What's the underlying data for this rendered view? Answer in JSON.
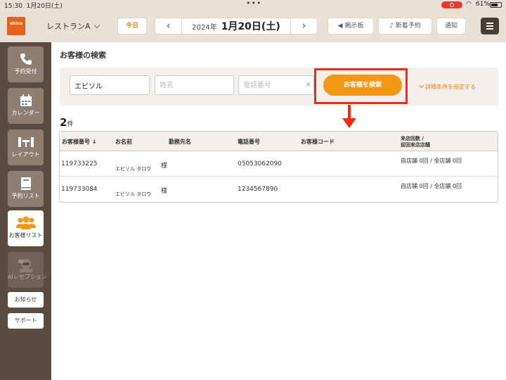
{
  "status_bar": {
    "time": "15:30",
    "date": "1月20日(土)",
    "battery": "61%"
  },
  "header": {
    "logo_text": "ebica",
    "restaurant": "レストランA",
    "today_label": "今日",
    "year": "2024年",
    "month_day": "1月20日(土)",
    "board_label": "掲示板",
    "new_res_label": "新着予約",
    "notice_label": "通知"
  },
  "sidebar": {
    "items": [
      {
        "label": "予約受付",
        "icon": "phone-icon"
      },
      {
        "label": "カレンダー",
        "icon": "calendar-icon"
      },
      {
        "label": "レイアウト",
        "icon": "layout-icon"
      },
      {
        "label": "予約リスト",
        "icon": "book-icon"
      },
      {
        "label": "お客様リスト",
        "icon": "customers-icon"
      },
      {
        "label": "AIレセプション",
        "icon": "ai-reception-icon"
      }
    ],
    "info_label": "お知らせ",
    "support_label": "サポート"
  },
  "main": {
    "title": "お客様の検索",
    "search": {
      "kana_value": "エビソル",
      "name_placeholder": "姓名",
      "phone_placeholder": "電話番号",
      "clear": "×",
      "button_label": "お客様を検索",
      "detail_label": "詳細条件を指定する"
    },
    "result_count": "2",
    "result_unit": "件",
    "table": {
      "headers": {
        "number": "お客様番号 ↓",
        "name": "お名前",
        "company": "勤務先名",
        "phone": "電話番号",
        "code": "お客様コード",
        "visits_1": "来店回数 /",
        "visits_2": "前回来店店舗"
      },
      "rows": [
        {
          "number": "119733225",
          "kana": "エビソル タロウ",
          "honorific": "様",
          "phone": "05053062090",
          "visits": "自店舗 0回 / 全店舗 0回"
        },
        {
          "number": "119733084",
          "kana": "エビソル タロウ",
          "honorific": "様",
          "phone": "1234567890",
          "visits": "自店舗 0回 / 全店舗 0回"
        }
      ]
    }
  },
  "colors": {
    "accent": "#f39717",
    "annotation": "#f02a14",
    "sidebar": "#5a4c41",
    "header_bg": "#e9e1d6"
  }
}
